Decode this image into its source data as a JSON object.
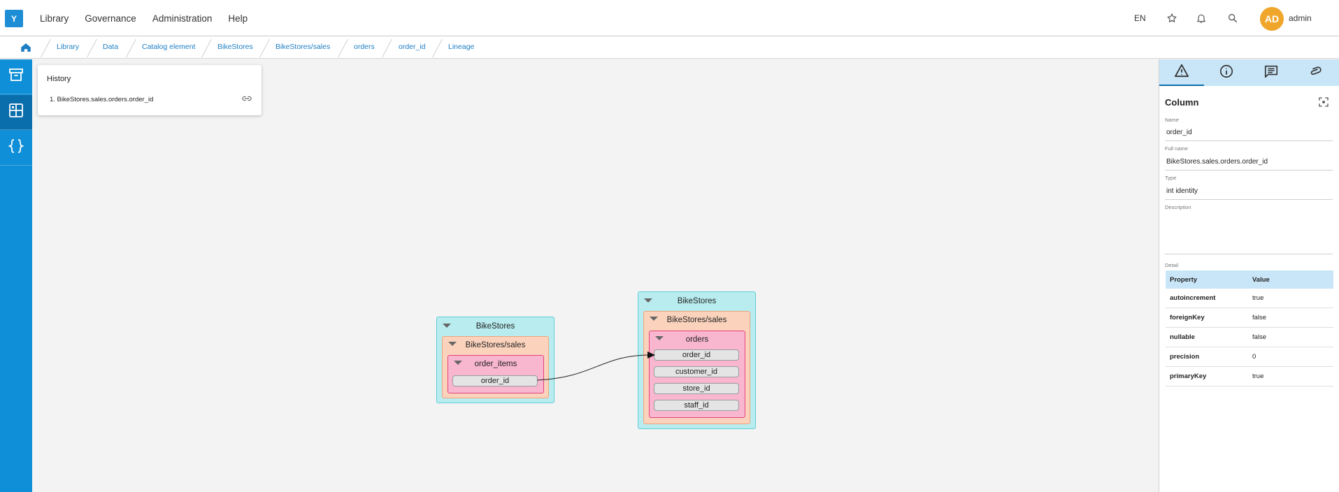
{
  "app": {
    "logo": "Y"
  },
  "menu": [
    "Library",
    "Governance",
    "Administration",
    "Help"
  ],
  "topright": {
    "lang": "EN",
    "user_initials": "AD",
    "user_name": "admin"
  },
  "breadcrumb": [
    "Library",
    "Data",
    "Catalog element",
    "BikeStores",
    "BikeStores/sales",
    "orders",
    "order_id",
    "Lineage"
  ],
  "history": {
    "title": "History",
    "items": [
      "1. BikeStores.sales.orders.order_id"
    ]
  },
  "lineage": {
    "source": {
      "database": "BikeStores",
      "schema": "BikeStores/sales",
      "table": "order_items",
      "columns": [
        "order_id"
      ]
    },
    "target": {
      "database": "BikeStores",
      "schema": "BikeStores/sales",
      "table": "orders",
      "columns": [
        "order_id",
        "customer_id",
        "store_id",
        "staff_id"
      ]
    }
  },
  "panel": {
    "title": "Column",
    "fields": {
      "name_label": "Name",
      "name_value": "order_id",
      "fullname_label": "Full name",
      "fullname_value": "BikeStores.sales.orders.order_id",
      "type_label": "Type",
      "type_value": "int identity",
      "description_label": "Description",
      "description_value": "",
      "detail_label": "Detail"
    },
    "detail_headers": {
      "property": "Property",
      "value": "Value"
    },
    "detail_rows": [
      {
        "property": "autoincrement",
        "value": "true"
      },
      {
        "property": "foreignKey",
        "value": "false"
      },
      {
        "property": "nullable",
        "value": "false"
      },
      {
        "property": "precision",
        "value": "0"
      },
      {
        "property": "primaryKey",
        "value": "true"
      }
    ]
  },
  "colors": {
    "brand": "#0f8fd7",
    "db_fill": "#b8ecee",
    "schema_fill": "#fbd3bd",
    "table_fill": "#f8b7cf",
    "avatar": "#f0a62a"
  },
  "icons": {
    "top": [
      "star-icon",
      "bell-icon",
      "search-icon"
    ],
    "sidebar": [
      "archive-icon",
      "dashboard-icon",
      "braces-icon"
    ],
    "panel_tabs": [
      "warning-icon",
      "info-icon",
      "comment-icon",
      "attachment-icon"
    ]
  }
}
